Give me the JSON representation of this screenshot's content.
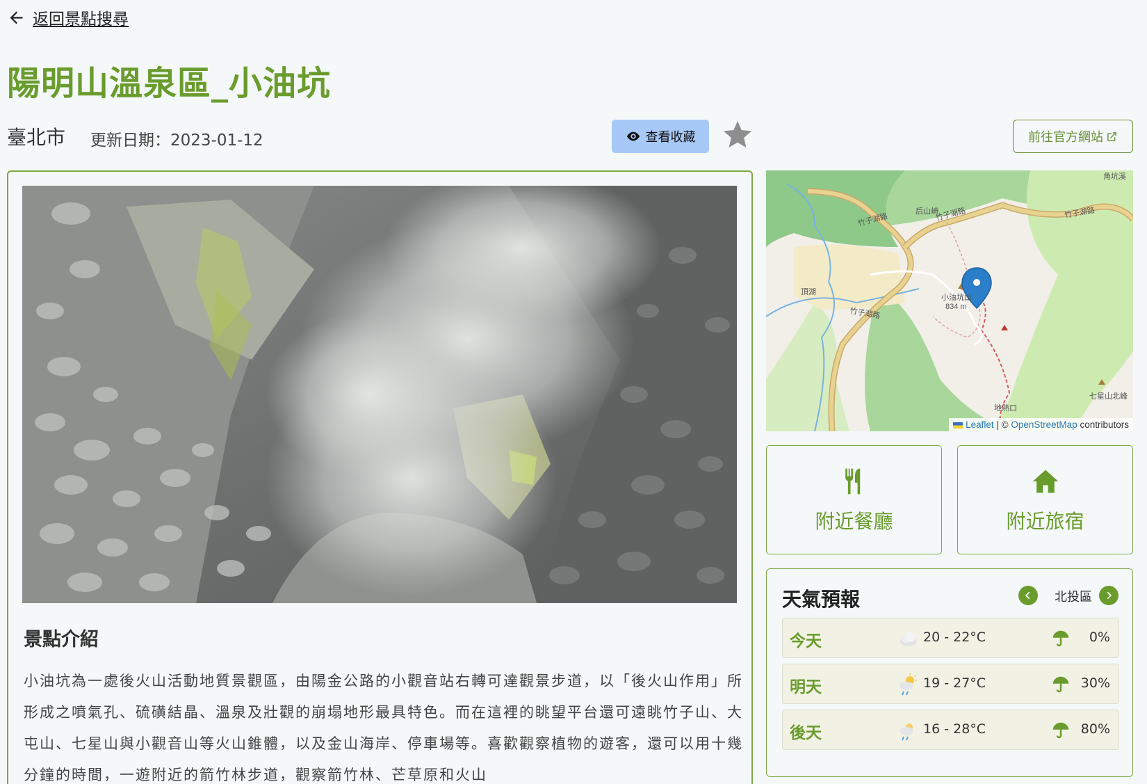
{
  "nav": {
    "back_label": "返回景點搜尋"
  },
  "page": {
    "title": "陽明山溫泉區_小油坑",
    "city": "臺北市",
    "updated": "更新日期：2023-01-12"
  },
  "actions": {
    "view_favorites": "查看收藏",
    "official_site": "前往官方網站"
  },
  "intro": {
    "title": "景點介紹",
    "text": "小油坑為一處後火山活動地質景觀區，由陽金公路的小觀音站右轉可達觀景步道，以「後火山作用」所形成之噴氣孔、硫磺結晶、溫泉及壯觀的崩塌地形最具特色。而在這裡的眺望平台還可遠眺竹子山、大屯山、七星山與小觀音山等火山錐體，以及金山海岸、停車場等。喜歡觀察植物的遊客，還可以用十幾分鐘的時間，一遊附近的箭竹林步道，觀察箭竹林、芒草原和火山"
  },
  "map": {
    "labels": {
      "road1": "竹子湖路",
      "road2": "竹子湖路",
      "road3": "竹子湖路",
      "road4": "竹子湖路",
      "place1": "后山崎",
      "place2": "頂湖",
      "peak_name": "小油坑山",
      "peak_height": "834 m",
      "place3": "地熱口",
      "place4": "七星山北峰",
      "place5": "角坑溪"
    },
    "attribution": {
      "leaflet": "Leaflet",
      "sep": " | © ",
      "osm": "OpenStreetMap",
      "contrib": " contributors"
    }
  },
  "nearby": {
    "restaurants": "附近餐廳",
    "lodging": "附近旅宿"
  },
  "weather": {
    "title": "天氣預報",
    "district": "北投區",
    "rows": [
      {
        "day": "今天",
        "temp": "20 - 22°C",
        "rain": "0%",
        "icon": "cloud-icon"
      },
      {
        "day": "明天",
        "temp": "19 - 27°C",
        "rain": "30%",
        "icon": "sun-cloud-rain-icon"
      },
      {
        "day": "後天",
        "temp": "16 - 28°C",
        "rain": "80%",
        "icon": "cloud-rain-icon"
      }
    ]
  },
  "colors": {
    "accent": "#6a9c2d",
    "button_blue": "#a6c9f7",
    "border": "#7fa646"
  }
}
